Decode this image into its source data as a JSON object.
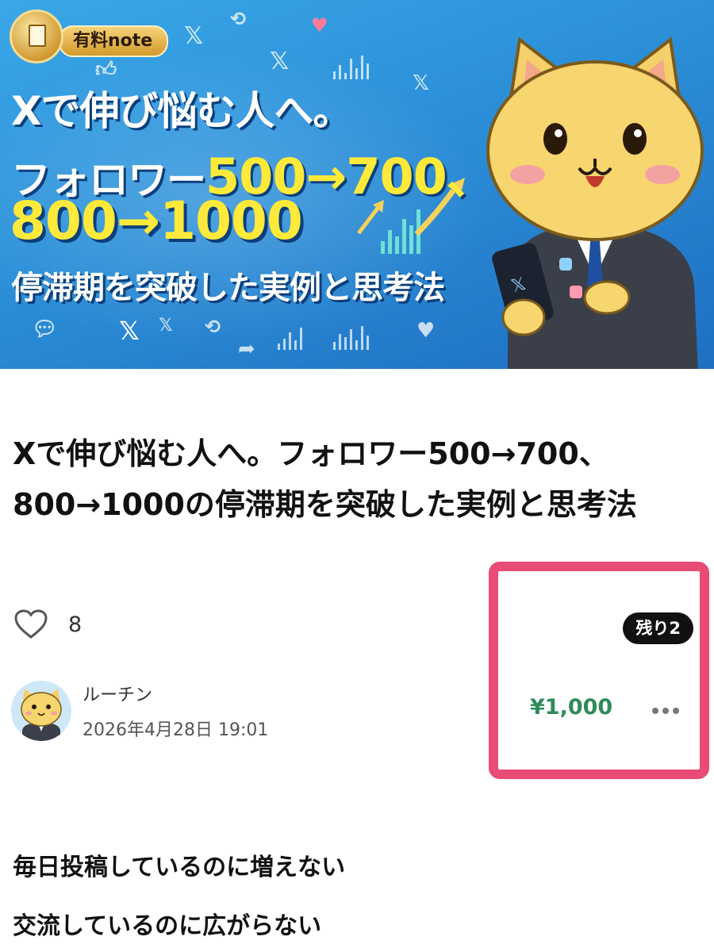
{
  "hero": {
    "badge": "有料note",
    "line1": "Xで伸び悩む人へ。",
    "line2_prefix": "フォロワー",
    "line2_highlight": "500→700、",
    "line3": "800→1000",
    "line4": "停滞期を突破した実例と思考法",
    "icons": [
      "x-logo-icon",
      "heart-icon",
      "retweet-icon",
      "like-icon",
      "share-icon",
      "comment-icon",
      "growth-arrow-icon"
    ]
  },
  "article": {
    "title": "Xで伸び悩む人へ。フォロワー500→700、800→1000の停滞期を突破した実例と思考法",
    "like_count": "8",
    "author_name": "ルーチン",
    "published": "2026年4月28日 19:01",
    "body_lines": [
      "毎日投稿しているのに増えない",
      "交流しているのに広がらない"
    ]
  },
  "price_card": {
    "stock": "残り2",
    "price": "¥1,000",
    "accent_color": "#e84b73",
    "price_color": "#2f8a5a"
  },
  "colors": {
    "hero_blue": "#2b8fd8",
    "highlight_yellow": "#ffe93a"
  }
}
